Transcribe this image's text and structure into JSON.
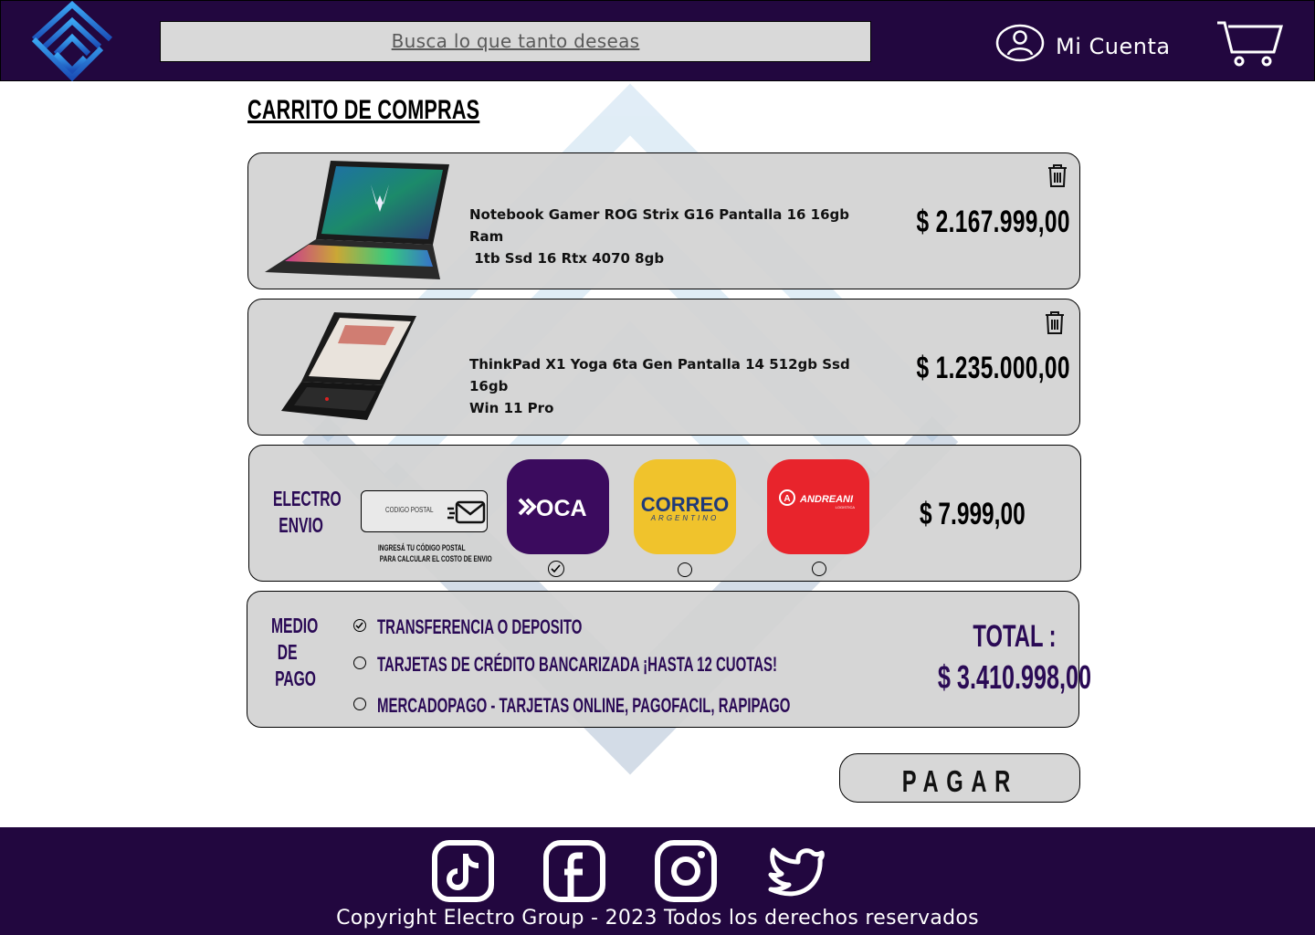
{
  "header": {
    "search_placeholder": "Busca lo que tanto deseas",
    "account_label": "Mi Cuenta"
  },
  "page": {
    "title": "CARRITO DE COMPRAS"
  },
  "cart": {
    "items": [
      {
        "name_line1": "Notebook Gamer ROG Strix G16 Pantalla 16 16gb Ram",
        "name_line2": " 1tb Ssd 16 Rtx 4070 8gb",
        "price": "$ 2.167.999,00"
      },
      {
        "name_line1": "ThinkPad X1 Yoga 6ta Gen Pantalla 14 512gb Ssd 16gb",
        "name_line2": "Win 11 Pro",
        "price": "$ 1.235.000,00"
      }
    ]
  },
  "shipping": {
    "label_line1": "ELECTRO",
    "label_line2": "ENVIO",
    "postal_placeholder": "CODIGO POSTAL",
    "hint_line1": "INGRESÁ TU CÓDIGO POSTAL",
    "hint_line2": " PARA CALCULAR EL COSTO DE ENVIO",
    "carriers": [
      {
        "name": "OCA",
        "selected": true,
        "color": "#3b0b5e"
      },
      {
        "name": "CORREO",
        "subname": "ARGENTINO",
        "selected": false,
        "color": "#f0c32c"
      },
      {
        "name": "ANDREANI",
        "subname": "LOGISTICA",
        "selected": false,
        "color": "#e8242c"
      }
    ],
    "price": "$ 7.999,00"
  },
  "payment": {
    "label_line1": "MEDIO",
    "label_line2": "DE",
    "label_line3": "PAGO",
    "options": [
      {
        "label": "TRANSFERENCIA O DEPOSITO",
        "selected": true
      },
      {
        "label": "TARJETAS DE CRÉDITO BANCARIZADA ¡HASTA 12 CUOTAS!",
        "selected": false
      },
      {
        "label": "MERCADOPAGO - TARJETAS ONLINE, PAGOFACIL, RAPIPAGO",
        "selected": false
      }
    ],
    "total_label": "TOTAL :",
    "total_value": "$ 3.410.998,00"
  },
  "actions": {
    "pay_label": "PAGAR"
  },
  "footer": {
    "social": [
      "tiktok-icon",
      "facebook-icon",
      "instagram-icon",
      "twitter-icon"
    ],
    "copyright": "Copyright  Electro Group - 2023 Todos los derechos reservados"
  },
  "colors": {
    "brand_dark": "#22073f",
    "accent_text": "#2a0a55",
    "logo_blue": "#2f8fe6",
    "card_bg": "#d2d2d2"
  }
}
